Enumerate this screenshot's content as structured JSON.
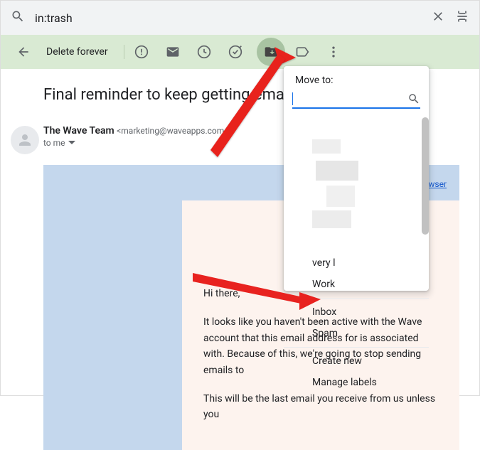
{
  "search": {
    "query": "in:trash"
  },
  "toolbar": {
    "delete_forever": "Delete forever"
  },
  "email": {
    "subject": "Final reminder to keep getting ema",
    "sender_name": "The Wave Team",
    "sender_email": "<marketing@waveapps.com",
    "to_line": "to me",
    "browser_link_text": "wser",
    "greeting": "Hi there,",
    "para1": "It looks like you haven't been active with the Wave account that this email address for is associated with. Because of this, we're going to stop sending emails to",
    "para2": "This will be the last email you receive from us unless you"
  },
  "popup": {
    "title": "Move to:",
    "items": {
      "very": "very l",
      "work": "Work",
      "inbox": "Inbox",
      "spam": "Spam",
      "create": "Create new",
      "manage": "Manage labels"
    }
  }
}
